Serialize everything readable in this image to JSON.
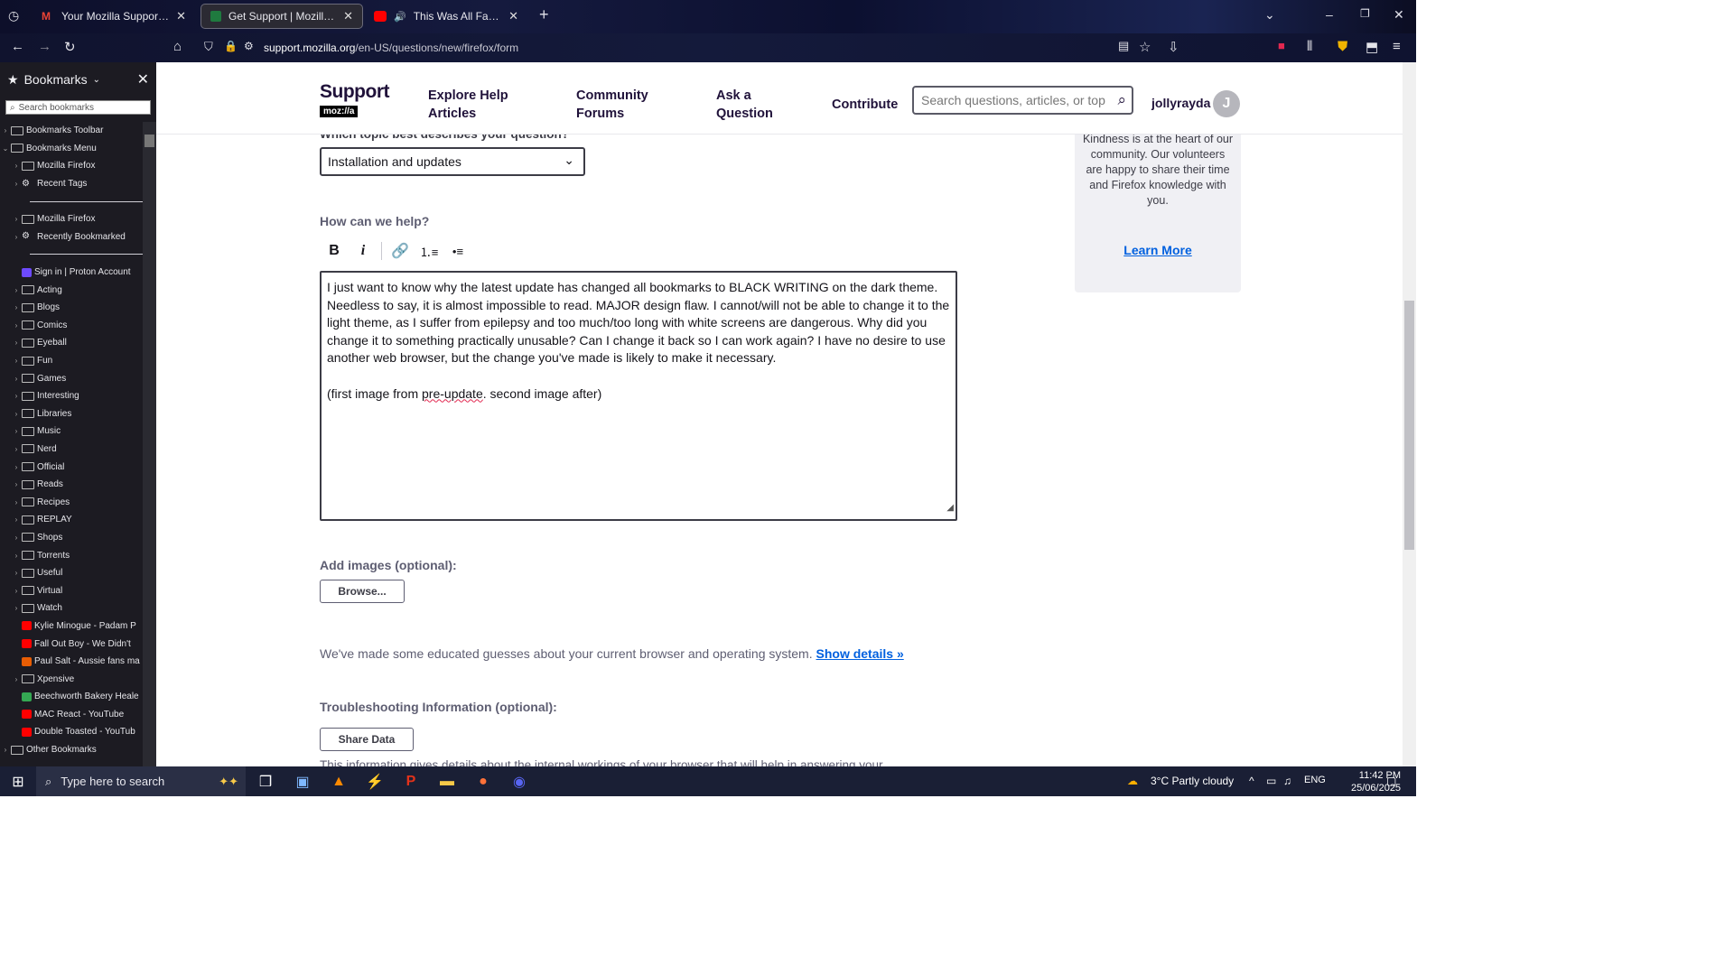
{
  "browser": {
    "tabs": [
      {
        "title": "Your Mozilla Support request h",
        "favicon": "gmail-icon",
        "active": false
      },
      {
        "title": "Get Support | Mozilla Support",
        "favicon": "support-icon",
        "active": true
      },
      {
        "title": "This Was All Fake?! Doctor",
        "favicon": "youtube-icon",
        "active": false
      }
    ],
    "url_host": "support.mozilla.org",
    "url_path": "/en-US/questions/new/firefox/form"
  },
  "sidebar": {
    "title": "Bookmarks",
    "search_placeholder": "Search bookmarks",
    "items": [
      {
        "label": "Bookmarks Toolbar",
        "indent": 0,
        "icon": "bookmarks-toolbar-icon"
      },
      {
        "label": "Bookmarks Menu",
        "indent": 0,
        "icon": "bookmarks-menu-icon",
        "expanded": true
      },
      {
        "label": "Mozilla Firefox",
        "indent": 1,
        "icon": "folder-icon"
      },
      {
        "label": "Recent Tags",
        "indent": 1,
        "icon": "gear-icon"
      },
      {
        "separator": true
      },
      {
        "label": "Mozilla Firefox",
        "indent": 1,
        "icon": "folder-icon"
      },
      {
        "label": "Recently Bookmarked",
        "indent": 1,
        "icon": "gear-icon"
      },
      {
        "separator": true
      },
      {
        "label": "Sign in | Proton Account",
        "indent": 1,
        "icon": "proton-icon"
      },
      {
        "label": "Acting",
        "indent": 1,
        "icon": "folder-icon"
      },
      {
        "label": "Blogs",
        "indent": 1,
        "icon": "folder-icon"
      },
      {
        "label": "Comics",
        "indent": 1,
        "icon": "folder-icon"
      },
      {
        "label": "Eyeball",
        "indent": 1,
        "icon": "folder-icon"
      },
      {
        "label": "Fun",
        "indent": 1,
        "icon": "folder-icon"
      },
      {
        "label": "Games",
        "indent": 1,
        "icon": "folder-icon"
      },
      {
        "label": "Interesting",
        "indent": 1,
        "icon": "folder-icon"
      },
      {
        "label": "Libraries",
        "indent": 1,
        "icon": "folder-icon"
      },
      {
        "label": "Music",
        "indent": 1,
        "icon": "folder-icon"
      },
      {
        "label": "Nerd",
        "indent": 1,
        "icon": "folder-icon"
      },
      {
        "label": "Official",
        "indent": 1,
        "icon": "folder-icon"
      },
      {
        "label": "Reads",
        "indent": 1,
        "icon": "folder-icon"
      },
      {
        "label": "Recipes",
        "indent": 1,
        "icon": "folder-icon"
      },
      {
        "label": "REPLAY",
        "indent": 1,
        "icon": "folder-icon"
      },
      {
        "label": "Shops",
        "indent": 1,
        "icon": "folder-icon"
      },
      {
        "label": "Torrents",
        "indent": 1,
        "icon": "folder-icon"
      },
      {
        "label": "Useful",
        "indent": 1,
        "icon": "folder-icon"
      },
      {
        "label": "Virtual",
        "indent": 1,
        "icon": "folder-icon"
      },
      {
        "label": "Watch",
        "indent": 1,
        "icon": "folder-icon"
      },
      {
        "label": "Kylie Minogue - Padam P",
        "indent": 1,
        "icon": "youtube-icon"
      },
      {
        "label": "Fall Out Boy - We Didn't",
        "indent": 1,
        "icon": "youtube-icon"
      },
      {
        "label": "Paul Salt - Aussie fans ma",
        "indent": 1,
        "icon": "news-icon"
      },
      {
        "label": "Xpensive",
        "indent": 1,
        "icon": "folder-icon"
      },
      {
        "label": "Beechworth Bakery Heale",
        "indent": 1,
        "icon": "map-pin-icon"
      },
      {
        "label": "MAC React - YouTube",
        "indent": 1,
        "icon": "youtube-icon"
      },
      {
        "label": "Double Toasted - YouTub",
        "indent": 1,
        "icon": "youtube-icon"
      },
      {
        "label": "Other Bookmarks",
        "indent": 0,
        "icon": "folder-icon"
      }
    ]
  },
  "header": {
    "logo_text": "Support",
    "logo_sub": "moz://a",
    "nav": [
      "Explore Help Articles",
      "Community Forums",
      "Ask a Question",
      "Contribute"
    ],
    "search_placeholder": "Search questions, articles, or top",
    "username": "jollyrayda",
    "avatar_letter": "J"
  },
  "form": {
    "topic_label_cut": "Which topic best describes your question?",
    "topic_value": "Installation and updates",
    "help_label": "How can we help?",
    "question_text_1": "I just want to know why the latest update has changed all bookmarks to BLACK WRITING on the dark theme. Needless to say, it is almost impossible to read. MAJOR design flaw. I cannot/will not be able to change it to the light theme, as I suffer from epilepsy and too much/too long with white screens are dangerous. Why did you change it to something practically unusable? Can I change it back so I can work again? I have no desire to use another web browser, but the change you've made is likely to make it necessary.",
    "question_text_2a": "(first image from ",
    "question_text_2b": "pre-update",
    "question_text_2c": ". second image after)",
    "images_label": "Add images (optional):",
    "browse_label": "Browse...",
    "guess_text": "We've made some educated guesses about your current browser and operating system. ",
    "show_details": "Show details »",
    "troubleshooting_label": "Troubleshooting Information (optional):",
    "share_data_label": "Share Data",
    "bottom_cut_text": "This information gives details about the internal workings of your browser that will help in answering your"
  },
  "kindness": {
    "text": "Kindness is at the heart of our community. Our volunteers are happy to share their time and Firefox knowledge with you.",
    "link": "Learn More"
  },
  "taskbar": {
    "search_placeholder": "Type here to search",
    "weather": "3°C  Partly cloudy",
    "language": "ENG",
    "time": "11:42 PM",
    "date": "25/06/2025"
  },
  "colors": {
    "link": "#0060df",
    "sidebar_bg": "#1c1b22",
    "text": "#20123a"
  }
}
